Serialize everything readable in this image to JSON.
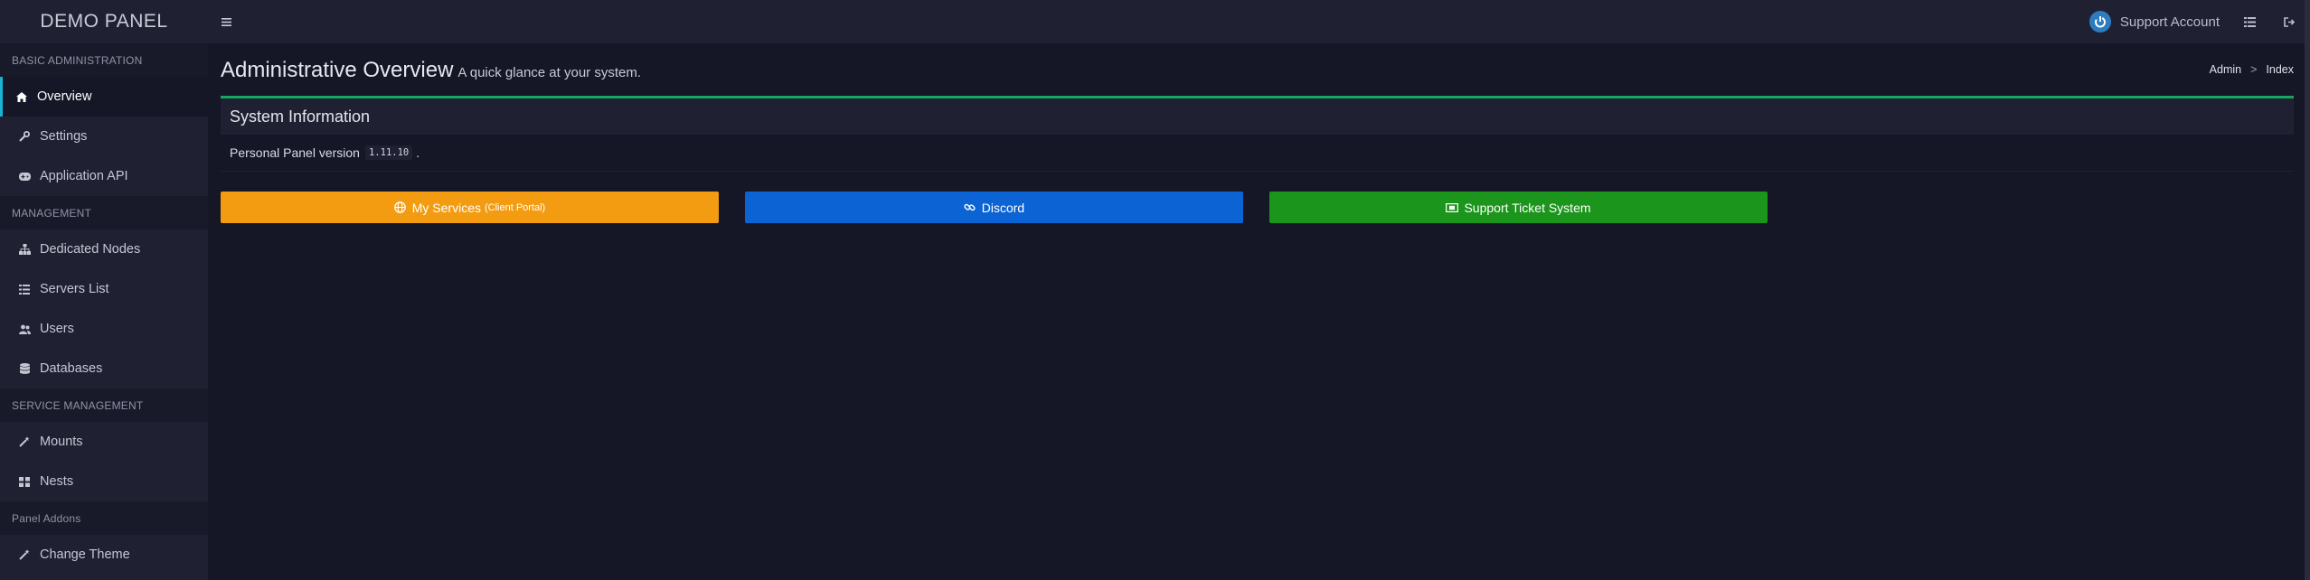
{
  "brand": "DEMO PANEL",
  "user": {
    "name": "Support Account"
  },
  "sidebar": {
    "sections": [
      {
        "header": "BASIC ADMINISTRATION",
        "items": [
          "Overview",
          "Settings",
          "Application API"
        ]
      },
      {
        "header": "MANAGEMENT",
        "items": [
          "Dedicated Nodes",
          "Servers List",
          "Users",
          "Databases"
        ]
      },
      {
        "header": "SERVICE MANAGEMENT",
        "items": [
          "Mounts",
          "Nests"
        ]
      },
      {
        "header": "Panel Addons",
        "items": [
          "Change Theme"
        ]
      }
    ]
  },
  "page": {
    "title": "Administrative Overview",
    "subtitle": "A quick glance at your system.",
    "breadcrumb": [
      "Admin",
      ">",
      "Index"
    ]
  },
  "system_box": {
    "title": "System Information",
    "text": "Personal Panel version",
    "version": "1.11.10",
    "trailing": "."
  },
  "buttons": {
    "services": {
      "label": "My Services",
      "small": "(Client Portal)",
      "color": "#f39c12"
    },
    "discord": {
      "label": "Discord",
      "color": "#0c63d4"
    },
    "support": {
      "label": "Support Ticket System",
      "color": "#1c951c"
    }
  },
  "colors": {
    "accent_active": "#17b4d4",
    "box_border": "#17a561",
    "background": "#151727",
    "sidebar": "#1f2133"
  },
  "icons": {
    "menu": "hamburger-icon",
    "avatar": "power-icon",
    "topbar_1": "list-icon",
    "topbar_2": "sign-out-icon"
  }
}
